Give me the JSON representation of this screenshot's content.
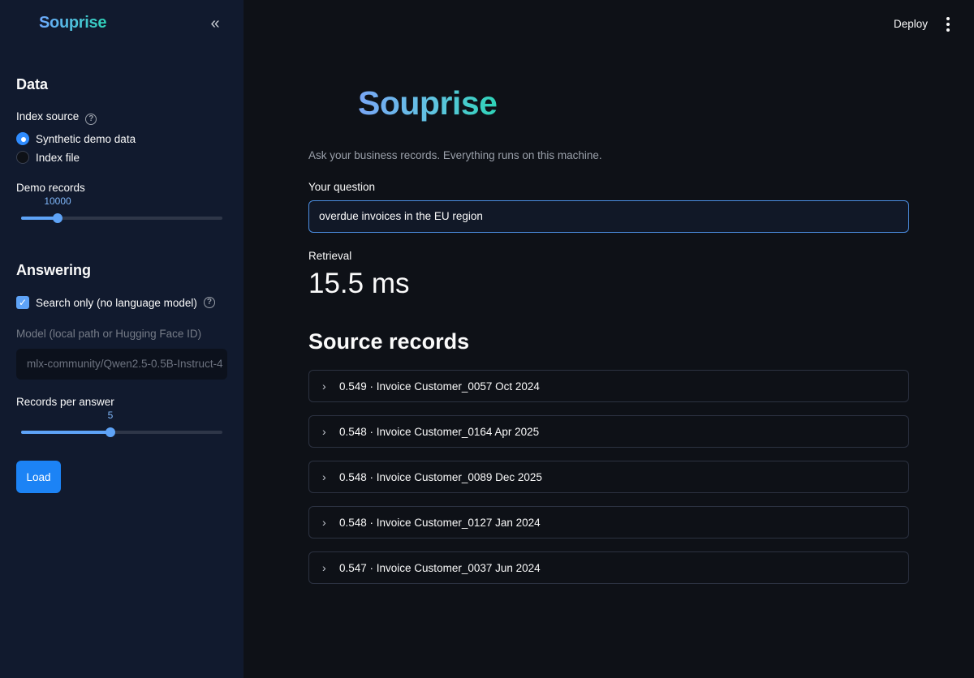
{
  "sidebar": {
    "logo": "Souprise",
    "collapse_icon": "«",
    "data_heading": "Data",
    "index_source_label": "Index source",
    "index_source_options": [
      {
        "label": "Synthetic demo data",
        "selected": true
      },
      {
        "label": "Index file",
        "selected": false
      }
    ],
    "demo_records_label": "Demo records",
    "demo_records_value": "10000",
    "demo_records_fraction": 0.18,
    "answering_heading": "Answering",
    "search_only_label": "Search only (no language model)",
    "search_only_checked": true,
    "model_label": "Model (local path or Hugging Face ID)",
    "model_value": "mlx-community/Qwen2.5-0.5B-Instruct-4",
    "records_per_answer_label": "Records per answer",
    "records_per_answer_value": "5",
    "records_per_answer_fraction": 0.444,
    "load_label": "Load"
  },
  "header": {
    "deploy_label": "Deploy",
    "menu_icon": "kebab-menu-icon"
  },
  "main": {
    "logo": "Souprise",
    "subtitle": "Ask your business records. Everything runs on this machine.",
    "question_label": "Your question",
    "question_value": "overdue invoices in the EU region",
    "retrieval_label": "Retrieval",
    "retrieval_value": "15.5 ms",
    "source_heading": "Source records",
    "records": [
      {
        "label": "0.549 · Invoice Customer_0057 Oct 2024"
      },
      {
        "label": "0.548 · Invoice Customer_0164 Apr 2025"
      },
      {
        "label": "0.548 · Invoice Customer_0089 Dec 2025"
      },
      {
        "label": "0.548 · Invoice Customer_0127 Jan 2024"
      },
      {
        "label": "0.547 · Invoice Customer_0037 Jun 2024"
      }
    ]
  },
  "colors": {
    "accent": "#1c83f5",
    "slider": "#5ea3f7",
    "background": "#0e1117",
    "sidebar": "#111a2e"
  }
}
